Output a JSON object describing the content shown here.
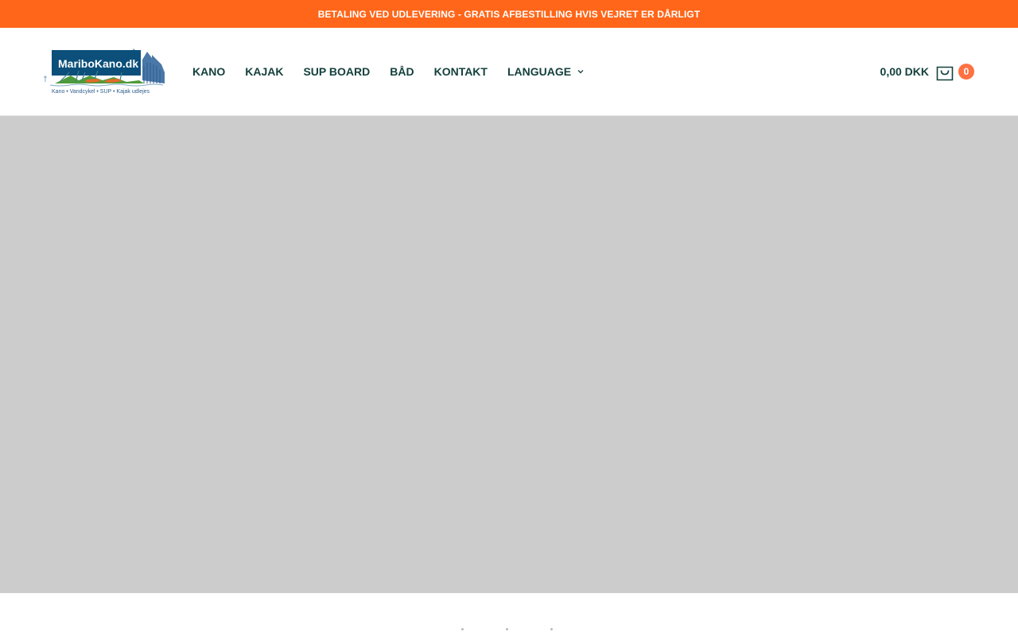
{
  "announcement": {
    "text": "BETALING VED UDLEVERING - GRATIS AFBESTILLING HVIS VEJRET ER DÅRLIGT"
  },
  "logo": {
    "brand_text": "MariboKano.dk",
    "tagline": "Kano • Vandcykel • SUP • Kajak udlejes"
  },
  "nav": {
    "items": [
      {
        "label": "KANO"
      },
      {
        "label": "KAJAK"
      },
      {
        "label": "SUP BOARD"
      },
      {
        "label": "BÅD"
      },
      {
        "label": "KONTAKT"
      },
      {
        "label": "LANGUAGE",
        "icon": "chevron-down-icon"
      }
    ]
  },
  "cart": {
    "total": "0,00 DKK",
    "count": "0",
    "icon": "shopping-bag-icon"
  },
  "colors": {
    "accent": "#ff6619",
    "badge": "#ff7043",
    "nav_text": "#14413d",
    "hero_placeholder": "#cccccc",
    "logo_blue": "#0b4f7a"
  }
}
